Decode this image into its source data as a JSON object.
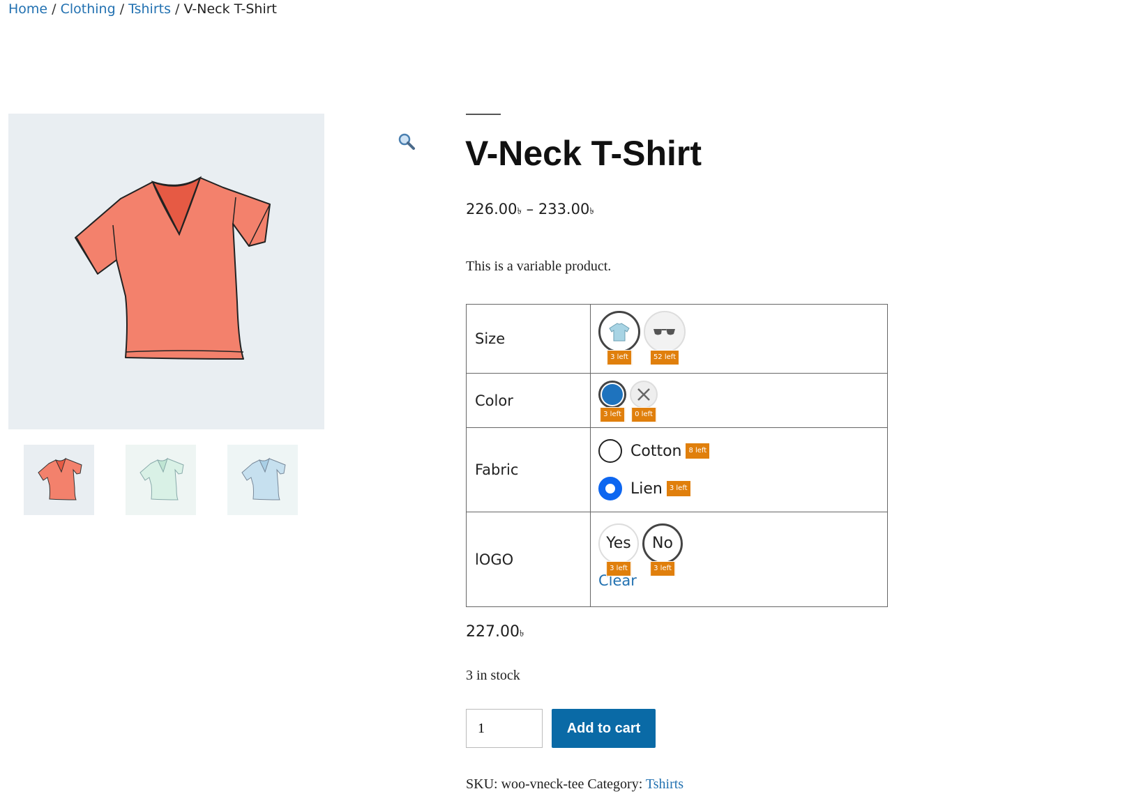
{
  "breadcrumb": {
    "items": [
      "Home",
      "Clothing",
      "Tshirts"
    ],
    "separator": "/",
    "current": "V-Neck T-Shirt"
  },
  "gallery": {
    "main_image": "vneck-tshirt-coral",
    "thumbnails": [
      "vneck-tshirt-coral",
      "vneck-tshirt-mint",
      "vneck-tshirt-lightblue"
    ],
    "zoom_icon": "magnifier-icon"
  },
  "product": {
    "title": "V-Neck T-Shirt",
    "price_min": "226.00",
    "price_max": "233.00",
    "price_dash": "–",
    "currency": "৳",
    "short_description": "This is a variable product."
  },
  "variations": {
    "size": {
      "label": "Size",
      "options": [
        {
          "icon": "tshirt-image",
          "stock": "3 left",
          "selected": true
        },
        {
          "icon": "sunglasses-image",
          "stock": "52 left",
          "selected": false
        }
      ]
    },
    "color": {
      "label": "Color",
      "options": [
        {
          "color": "#1e73be",
          "stock": "3 left",
          "selected": true
        },
        {
          "icon": "x-icon",
          "stock": "0 left",
          "selected": false
        }
      ]
    },
    "fabric": {
      "label": "Fabric",
      "options": [
        {
          "name": "Cotton",
          "stock": "8 left",
          "selected": false
        },
        {
          "name": "Lien",
          "stock": "3 left",
          "selected": true
        }
      ]
    },
    "logo": {
      "label": "lOGO",
      "options": [
        {
          "name": "Yes",
          "stock": "3 left",
          "selected": false
        },
        {
          "name": "No",
          "stock": "3 left",
          "selected": true
        }
      ]
    },
    "clear_label": "Clear"
  },
  "variation_info": {
    "price": "227.00",
    "stock": "3 in stock"
  },
  "cart": {
    "quantity": "1",
    "button_label": "Add to cart"
  },
  "meta": {
    "sku_label": "SKU:",
    "sku": "woo-vneck-tee",
    "category_label": "Category:",
    "category": "Tshirts"
  },
  "colors": {
    "link": "#2271b1",
    "button": "#0a6aa6",
    "badge": "#e07f0c",
    "radio_checked": "#0d66f0",
    "swatch_blue": "#1e73be"
  }
}
